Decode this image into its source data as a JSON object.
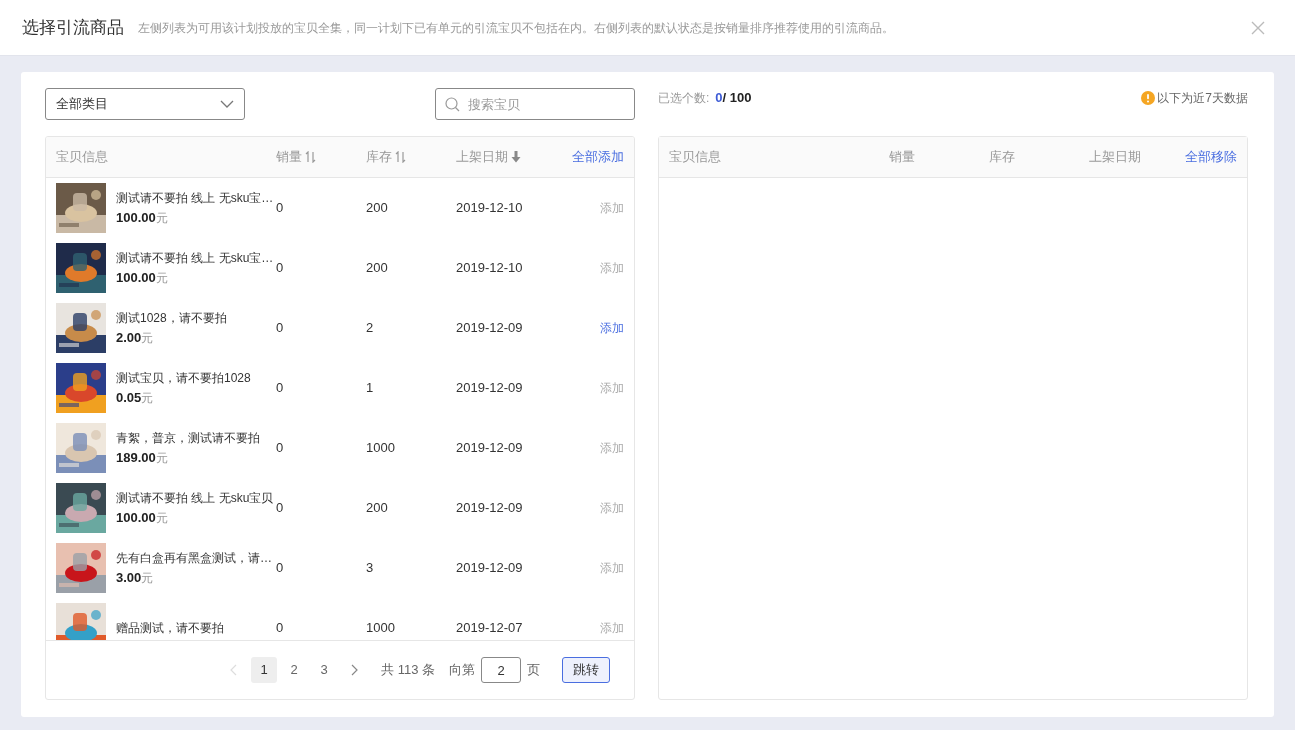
{
  "dialog": {
    "title": "选择引流商品",
    "description": "左侧列表为可用该计划投放的宝贝全集，同一计划下已有单元的引流宝贝不包括在内。右侧列表的默认状态是按销量排序推荐使用的引流商品。"
  },
  "left": {
    "category": {
      "value": "全部类目"
    },
    "search": {
      "placeholder": "搜索宝贝"
    },
    "columns": [
      {
        "label": "宝贝信息",
        "kind": "plain"
      },
      {
        "label": "销量",
        "kind": "sortable"
      },
      {
        "label": "库存",
        "kind": "sortable"
      },
      {
        "label": "上架日期",
        "kind": "sorted"
      }
    ],
    "add_all": "全部添加",
    "rows": [
      {
        "name": "测试请不要拍 线上 无sku宝…",
        "price": "100.00",
        "unit": "元",
        "sales": "0",
        "stock": "200",
        "date": "2019-12-10",
        "action": "添加",
        "highlighted": false
      },
      {
        "name": "测试请不要拍 线上 无sku宝…",
        "price": "100.00",
        "unit": "元",
        "sales": "0",
        "stock": "200",
        "date": "2019-12-10",
        "action": "添加",
        "highlighted": false
      },
      {
        "name": "测试1028，请不要拍",
        "price": "2.00",
        "unit": "元",
        "sales": "0",
        "stock": "2",
        "date": "2019-12-09",
        "action": "添加",
        "highlighted": true
      },
      {
        "name": "测试宝贝，请不要拍1028",
        "price": "0.05",
        "unit": "元",
        "sales": "0",
        "stock": "1",
        "date": "2019-12-09",
        "action": "添加",
        "highlighted": false
      },
      {
        "name": "青絮，普京，测试请不要拍",
        "price": "189.00",
        "unit": "元",
        "sales": "0",
        "stock": "1000",
        "date": "2019-12-09",
        "action": "添加",
        "highlighted": false
      },
      {
        "name": "测试请不要拍 线上 无sku宝贝",
        "price": "100.00",
        "unit": "元",
        "sales": "0",
        "stock": "200",
        "date": "2019-12-09",
        "action": "添加",
        "highlighted": false
      },
      {
        "name": "先有白盒再有黑盒测试，请…",
        "price": "3.00",
        "unit": "元",
        "sales": "0",
        "stock": "3",
        "date": "2019-12-09",
        "action": "添加",
        "highlighted": false
      },
      {
        "name": "赠品测试，请不要拍",
        "sales": "0",
        "stock": "1000",
        "date": "2019-12-07",
        "action": "添加",
        "highlighted": false
      }
    ],
    "pagination": {
      "pages": [
        {
          "label": "1",
          "selected": true
        },
        {
          "label": "2",
          "selected": false
        },
        {
          "label": "3",
          "selected": false
        }
      ],
      "total": "共 113 条",
      "goto_label": "向第",
      "goto_value": "2",
      "page_unit": "页",
      "jump": "跳转"
    }
  },
  "right": {
    "count_label": "已选个数:",
    "count": "0",
    "max": "/ 100",
    "notice": "以下为近7天数据",
    "columns": [
      {
        "label": "宝贝信息"
      },
      {
        "label": "销量"
      },
      {
        "label": "库存"
      },
      {
        "label": "上架日期"
      }
    ],
    "remove_all": "全部移除"
  }
}
